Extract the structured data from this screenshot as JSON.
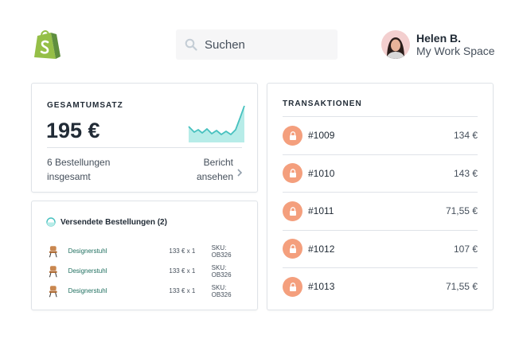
{
  "search": {
    "placeholder": "Suchen"
  },
  "user": {
    "name": "Helen B.",
    "workspace": "My Work Space"
  },
  "sales": {
    "title": "GESAMTUMSATZ",
    "value": "195 €",
    "orders_line1": "6 Bestellungen",
    "orders_line2": "insgesamt",
    "report_line1": "Bericht",
    "report_line2": "ansehen"
  },
  "shipping": {
    "title": "Versendete Bestellungen (2)",
    "items": [
      {
        "product": "Designerstuhl",
        "price": "133 € x 1",
        "sku": "SKU: OB326"
      },
      {
        "product": "Designerstuhl",
        "price": "133 € x 1",
        "sku": "SKU: OB326"
      },
      {
        "product": "Designerstuhl",
        "price": "133 € x 1",
        "sku": "SKU: OB326"
      }
    ]
  },
  "transactions": {
    "title": "TRANSAKTIONEN",
    "items": [
      {
        "id": "#1009",
        "amount": "134 €"
      },
      {
        "id": "#1010",
        "amount": "143 €"
      },
      {
        "id": "#1011",
        "amount": "71,55 €"
      },
      {
        "id": "#1012",
        "amount": "107 €"
      },
      {
        "id": "#1013",
        "amount": "71,55 €"
      }
    ]
  },
  "colors": {
    "brand_green": "#95bf47",
    "teal": "#47c1bf",
    "teal_fill": "#b7ece8",
    "lock_orange": "#f49f7d",
    "link_green": "#207060"
  }
}
